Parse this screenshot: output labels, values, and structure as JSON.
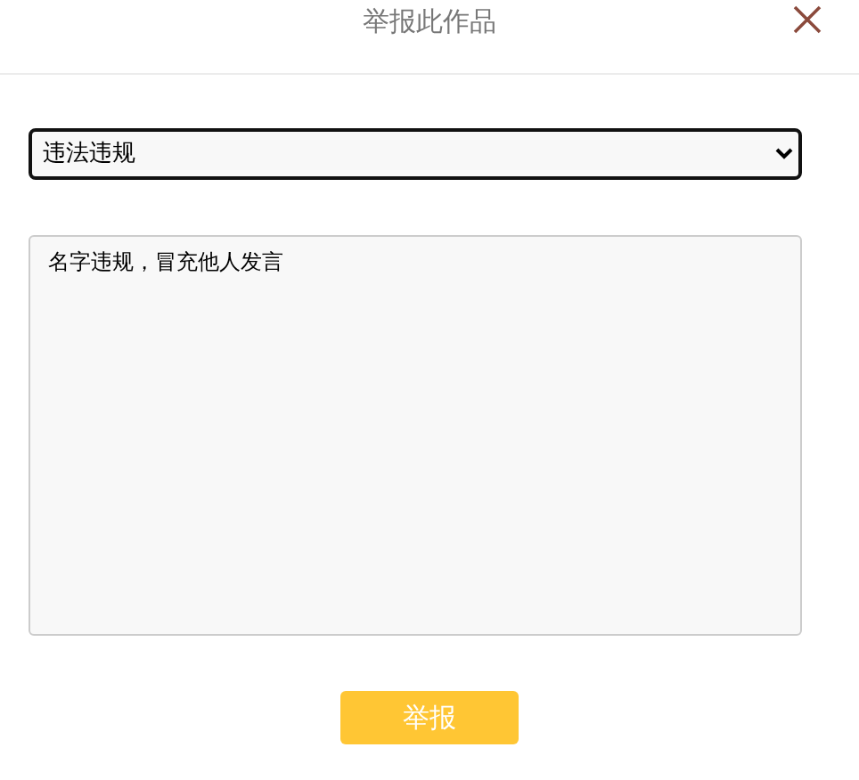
{
  "dialog": {
    "title": "举报此作品"
  },
  "reason_select": {
    "value": "违法违规"
  },
  "description": {
    "value": "名字违规，冒充他人发言"
  },
  "submit_button": {
    "label": "举报"
  }
}
